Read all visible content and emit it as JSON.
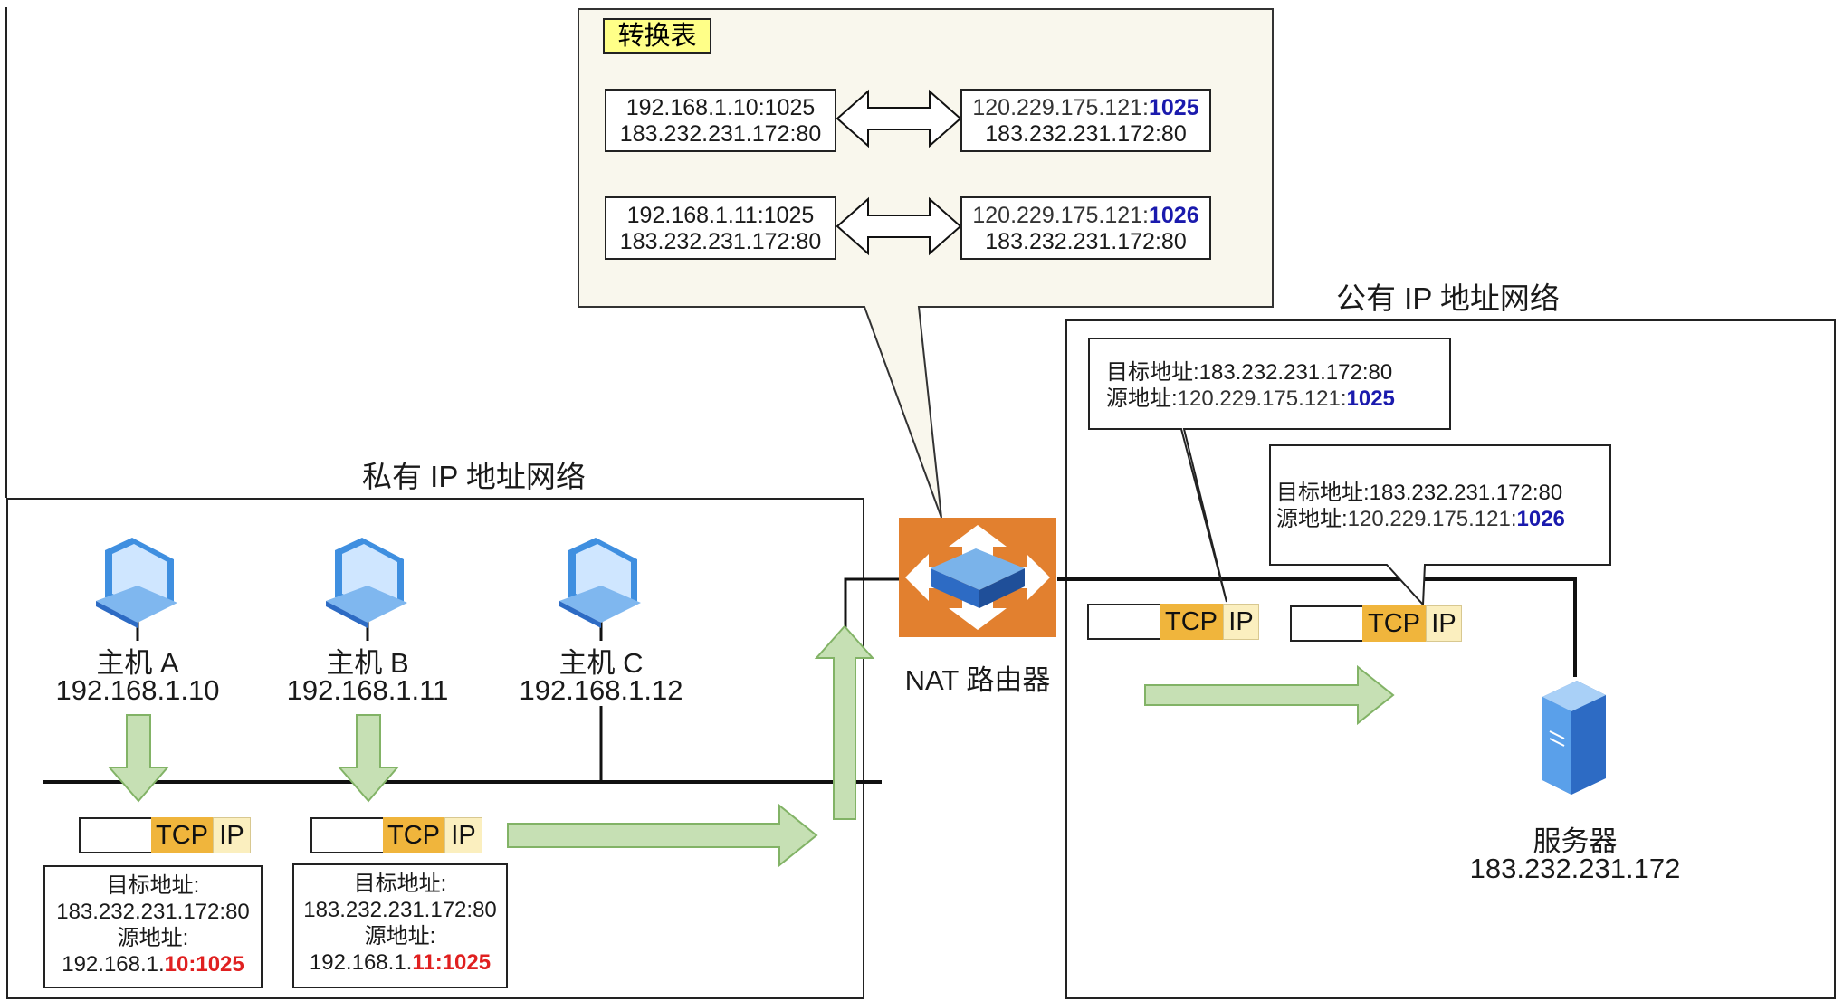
{
  "table": {
    "title": "转换表",
    "rows": [
      {
        "private_line1": "192.168.1.10:1025",
        "private_line2": "183.232.231.172:80",
        "public_prefix": "120.229.175.121:",
        "public_port": "1025",
        "public_line2": "183.232.231.172:80"
      },
      {
        "private_line1": "192.168.1.11:1025",
        "private_line2": "183.232.231.172:80",
        "public_prefix": "120.229.175.121:",
        "public_port": "1026",
        "public_line2": "183.232.231.172:80"
      }
    ]
  },
  "private_network": {
    "label": "私有 IP 地址网络",
    "hosts": [
      {
        "name": "主机 A",
        "ip": "192.168.1.10"
      },
      {
        "name": "主机 B",
        "ip": "192.168.1.11"
      },
      {
        "name": "主机 C",
        "ip": "192.168.1.12"
      }
    ],
    "packets": [
      {
        "tcp": "TCP",
        "ip": "IP",
        "dst_label": "目标地址:",
        "dst": "183.232.231.172:80",
        "src_label": "源地址:",
        "src_prefix": "192.168.1.",
        "src_highlight": "10:1025"
      },
      {
        "tcp": "TCP",
        "ip": "IP",
        "dst_label": "目标地址:",
        "dst": "183.232.231.172:80",
        "src_label": "源地址:",
        "src_prefix": "192.168.1.",
        "src_highlight": "11:1025"
      }
    ]
  },
  "router": {
    "label": "NAT 路由器"
  },
  "public_network": {
    "label": "公有 IP 地址网络",
    "callouts": [
      {
        "dst_label": "目标地址:",
        "dst": "183.232.231.172:80",
        "src_label": "源地址:",
        "src_prefix": "120.229.175.121:",
        "src_port": "1025"
      },
      {
        "dst_label": "目标地址:",
        "dst": "183.232.231.172:80",
        "src_label": "源地址:",
        "src_prefix": "120.229.175.121:",
        "src_port": "1026"
      }
    ],
    "packets": [
      {
        "tcp": "TCP",
        "ip": "IP"
      },
      {
        "tcp": "TCP",
        "ip": "IP"
      }
    ]
  },
  "server": {
    "name": "服务器",
    "ip": "183.232.231.172"
  },
  "colors": {
    "router": "#e2802f",
    "arrow_fill": "#c6e0b4",
    "arrow_stroke": "#82b366",
    "tcp": "#f0b53c",
    "ip": "#fbefbf",
    "bubble": "#f9f7ed",
    "highlight_blue": "#1a1aad",
    "highlight_red": "#e02020"
  }
}
